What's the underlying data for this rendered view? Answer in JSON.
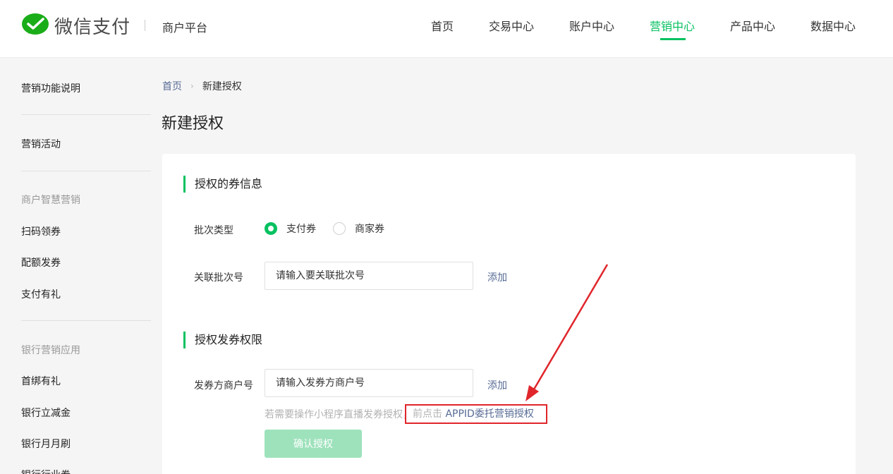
{
  "header": {
    "logo_text": "微信支付",
    "platform": "商户平台",
    "nav": [
      {
        "label": "首页"
      },
      {
        "label": "交易中心"
      },
      {
        "label": "账户中心"
      },
      {
        "label": "营销中心",
        "active": true
      },
      {
        "label": "产品中心"
      },
      {
        "label": "数据中心"
      }
    ]
  },
  "sidebar": {
    "items": [
      {
        "type": "item",
        "label": "营销功能说明"
      },
      {
        "type": "item",
        "label": "营销活动"
      },
      {
        "type": "group",
        "label": "商户智慧营销"
      },
      {
        "type": "item",
        "label": "扫码领券"
      },
      {
        "type": "item",
        "label": "配额发券"
      },
      {
        "type": "item",
        "label": "支付有礼"
      },
      {
        "type": "group",
        "label": "银行营销应用"
      },
      {
        "type": "item",
        "label": "首绑有礼"
      },
      {
        "type": "item",
        "label": "银行立减金"
      },
      {
        "type": "item",
        "label": "银行月月刷"
      },
      {
        "type": "item",
        "label": "银行行业券"
      }
    ]
  },
  "breadcrumb": {
    "home": "首页",
    "separator": "›",
    "current": "新建授权"
  },
  "page_title": "新建授权",
  "form": {
    "section1_title": "授权的券信息",
    "batch_type_label": "批次类型",
    "radio_options": [
      {
        "label": "支付券",
        "checked": true
      },
      {
        "label": "商家券",
        "checked": false
      }
    ],
    "batch_no_label": "关联批次号",
    "batch_no_placeholder": "请输入要关联批次号",
    "add_label": "添加",
    "section2_title": "授权发券权限",
    "issuer_label": "发券方商户号",
    "issuer_placeholder": "请输入发券方商户号",
    "hint_text": "若需要操作小程序直播发券授权，",
    "hint_pre": "前点击 ",
    "hint_link": "APPID委托营销授权",
    "confirm_label": "确认授权"
  },
  "colors": {
    "brand": "#07c160",
    "link": "#576b95",
    "annotation": "#e0262b"
  },
  "icons": [
    "wechat-pay-logo-icon",
    "chevron-right-icon",
    "annotation-arrow-icon"
  ]
}
